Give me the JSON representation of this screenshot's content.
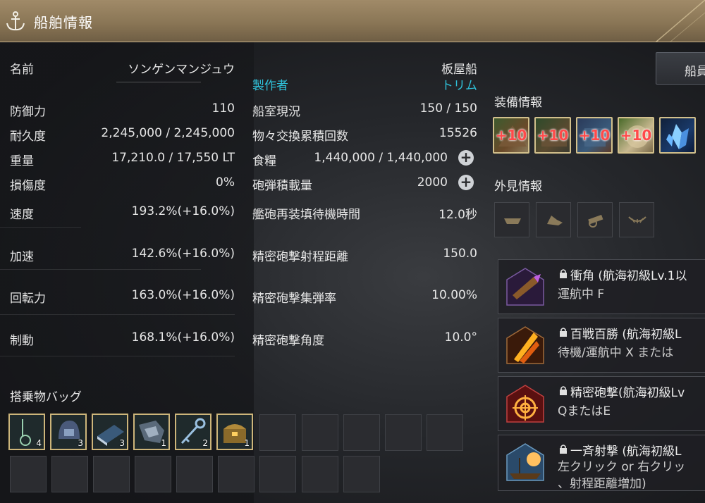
{
  "window": {
    "title": "船舶情報"
  },
  "ship": {
    "name_label": "名前",
    "name_value": "ソンゲンマンジュウ",
    "type": "板屋船",
    "maker_label": "製作者",
    "maker_value": "トリム"
  },
  "left_stats": [
    {
      "label": "防御力",
      "value": "110"
    },
    {
      "label": "耐久度",
      "value": "2,245,000 / 2,245,000"
    },
    {
      "label": "重量",
      "value": "17,210.0 / 17,550 LT"
    },
    {
      "label": "損傷度",
      "value": "0%"
    },
    {
      "label": "速度",
      "value": "193.2%(+16.0%)"
    },
    {
      "label": "加速",
      "value": "142.6%(+16.0%)"
    },
    {
      "label": "回転力",
      "value": "163.0%(+16.0%)"
    },
    {
      "label": "制動",
      "value": "168.1%(+16.0%)"
    }
  ],
  "mid_stats": [
    {
      "label": "船室現況",
      "value": "150 / 150"
    },
    {
      "label": "物々交換累積回数",
      "value": "15526"
    },
    {
      "label": "食糧",
      "value": "1,440,000 / 1,440,000"
    },
    {
      "label": "砲弾積載量",
      "value": "2000"
    },
    {
      "label": "艦砲再装填待機時間",
      "value": "12.0秒"
    },
    {
      "label": "精密砲撃射程距離",
      "value": "150.0"
    },
    {
      "label": "精密砲撃集弾率",
      "value": "10.00%"
    },
    {
      "label": "精密砲撃角度",
      "value": "10.0°"
    }
  ],
  "crew_button": "船員",
  "equipment": {
    "title": "装備情報",
    "slots": [
      {
        "badge": "+10",
        "icon": "ship-bow-icon"
      },
      {
        "badge": "+10",
        "icon": "ship-hull-icon"
      },
      {
        "badge": "+10",
        "icon": "ship-cannon-icon"
      },
      {
        "badge": "+10",
        "icon": "ship-sail-icon"
      },
      {
        "badge": "",
        "icon": "blue-crystal-icon"
      }
    ]
  },
  "appearance": {
    "title": "外見情報",
    "slots": [
      "boat-deco-icon",
      "flag-deco-icon",
      "cannon-deco-icon",
      "bow-deco-icon"
    ]
  },
  "skills": [
    {
      "name": "衝角 (航海初級Lv.1以",
      "key": "運航中 F",
      "icon": "ram-skill-icon"
    },
    {
      "name": "百戦百勝 (航海初級L",
      "key": "待機/運航中 X または",
      "icon": "victory-skill-icon"
    },
    {
      "name": "精密砲撃(航海初級Lv",
      "key": "QまたはE",
      "icon": "precision-shot-icon"
    },
    {
      "name": "一斉射撃 (航海初級L",
      "key": "左クリック or 右クリッ",
      "extra": "、射程距離増加)",
      "icon": "broadside-icon"
    }
  ],
  "bag": {
    "title": "搭乗物バッグ",
    "items": [
      {
        "icon": "anchor-charm-icon",
        "count": "4"
      },
      {
        "icon": "helmet-icon",
        "count": "3"
      },
      {
        "icon": "book-icon",
        "count": "3"
      },
      {
        "icon": "dragon-scale-icon",
        "count": "1"
      },
      {
        "icon": "key-icon",
        "count": "2"
      },
      {
        "icon": "treasure-chest-icon",
        "count": "1"
      }
    ]
  },
  "colors": {
    "accent": "#2fc0d8",
    "gold_border": "#cdb57a",
    "title_bar": "#8a7656"
  }
}
